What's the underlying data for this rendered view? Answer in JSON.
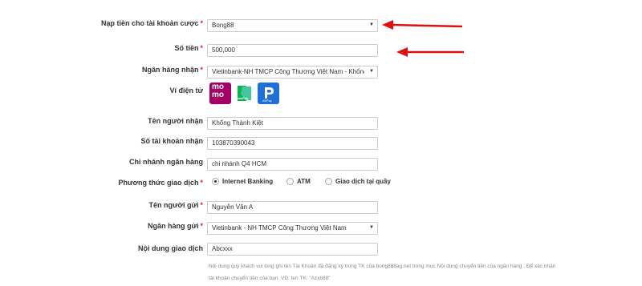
{
  "form": {
    "account_label": "Nạp tiền cho tài khoản cược",
    "account_value": "Bong88",
    "amount_label": "Số tiền",
    "amount_value": "500,000",
    "receive_bank_label": "Ngân hàng nhận",
    "receive_bank_value": "Vietinbank-NH TMCP Công Thương Việt Nam - Khống",
    "wallet_label": "Ví điện tử",
    "wallets": {
      "momo_top": "mo",
      "momo_bottom": "mo",
      "zalo_text": "ZaloPay",
      "airpay_text": "AirPay"
    },
    "receiver_name_label": "Tên người nhận",
    "receiver_name_value": "Khổng Thành Kiệt",
    "receiver_account_label": "Số tài khoản nhận",
    "receiver_account_value": "103870390043",
    "branch_label": "Chi nhánh ngân hàng",
    "branch_value": "chi nhánh Q4 HCM",
    "method_label": "Phương thức giao dịch",
    "methods": [
      "Internet Banking",
      "ATM",
      "Giao dịch tại quầy"
    ],
    "sender_name_label": "Tên người gửi",
    "sender_name_value": "Nguyễn Văn A",
    "sender_bank_label": "Ngân hàng gửi",
    "sender_bank_value": "Vietinbank - NH TMCP Công Thương Việt Nam",
    "content_label": "Nội dung giao dịch",
    "content_value": "Abcxxx",
    "note_line1": "Nội dung quý khách vui lòng ghi tên Tài Khoản đã đăng ký trong TK của bong888ag.net trong mục Nội dung chuyển tiền của ngân hàng . Để xác nhận",
    "note_line2": "tài khoản chuyển tiền của bạn. VD: ten TK: \"Azxb88\""
  },
  "colors": {
    "arrow": "#e01010",
    "momo": "#a50064",
    "zalo": "#0ab34f",
    "airpay": "#1e6fd9"
  }
}
